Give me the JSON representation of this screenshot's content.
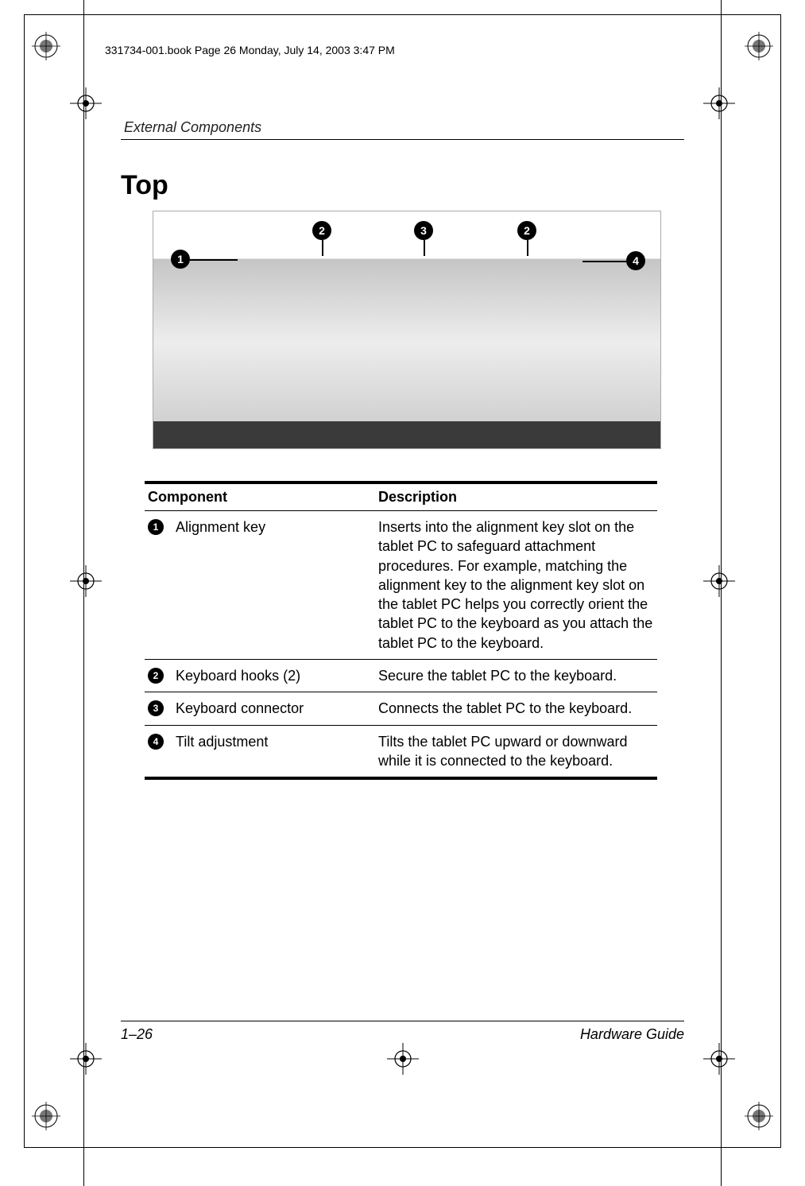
{
  "print_header": "331734-001.book  Page 26  Monday, July 14, 2003  3:47 PM",
  "running_head": "External Components",
  "section_title": "Top",
  "callouts": {
    "c1": "1",
    "c2a": "2",
    "c3": "3",
    "c2b": "2",
    "c4": "4"
  },
  "table": {
    "headers": {
      "component": "Component",
      "description": "Description"
    },
    "rows": [
      {
        "num": "1",
        "component": "Alignment key",
        "description": "Inserts into the alignment key slot on the tablet PC to safeguard attachment procedures. For example, matching the alignment key to the alignment key slot on the tablet PC helps you correctly orient the tablet PC to the keyboard as you attach the tablet PC to the keyboard."
      },
      {
        "num": "2",
        "component": "Keyboard hooks (2)",
        "description": "Secure the tablet PC to the keyboard."
      },
      {
        "num": "3",
        "component": "Keyboard connector",
        "description": "Connects the tablet PC to the keyboard."
      },
      {
        "num": "4",
        "component": "Tilt adjustment",
        "description": "Tilts the tablet PC upward or downward while it is connected to the keyboard."
      }
    ]
  },
  "footer": {
    "page": "1–26",
    "doc": "Hardware Guide"
  }
}
